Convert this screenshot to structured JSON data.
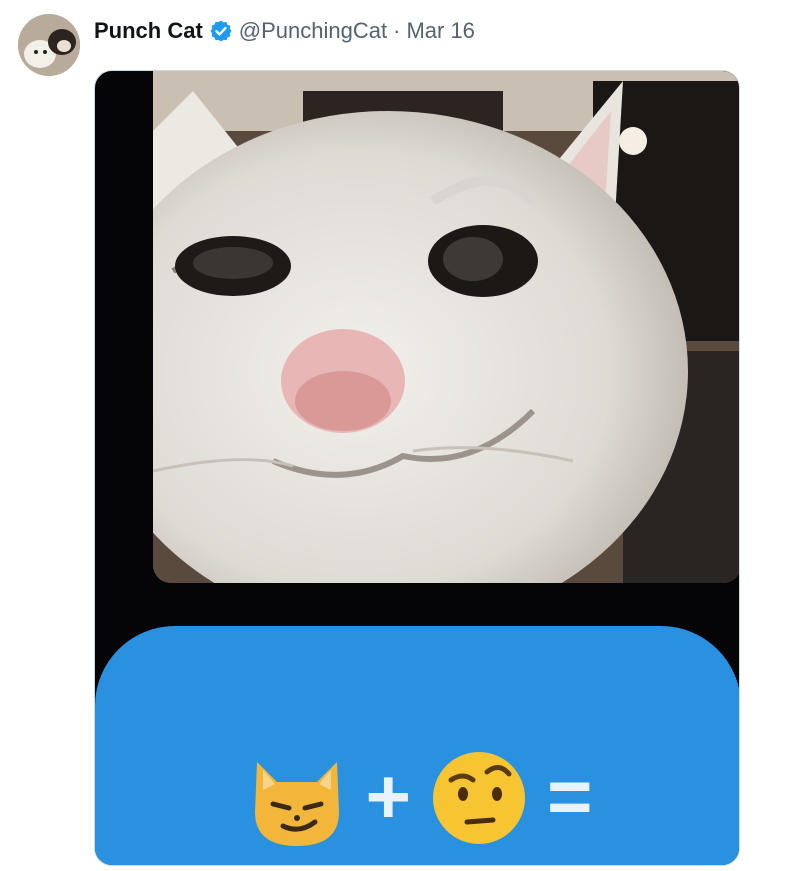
{
  "tweet": {
    "author_name": "Punch Cat",
    "handle": "@PunchingCat",
    "separator": "·",
    "date": "Mar 16",
    "verified": true
  },
  "media": {
    "alt_icons": [
      "smirking-cat-icon",
      "raised-eyebrow-face-icon"
    ],
    "operators": {
      "plus": "+",
      "equals": "="
    }
  },
  "colors": {
    "bubble": "#2a91e0",
    "verified_badge": "#1d9bf0",
    "handle_text": "#536471",
    "name_text": "#0f1419"
  }
}
